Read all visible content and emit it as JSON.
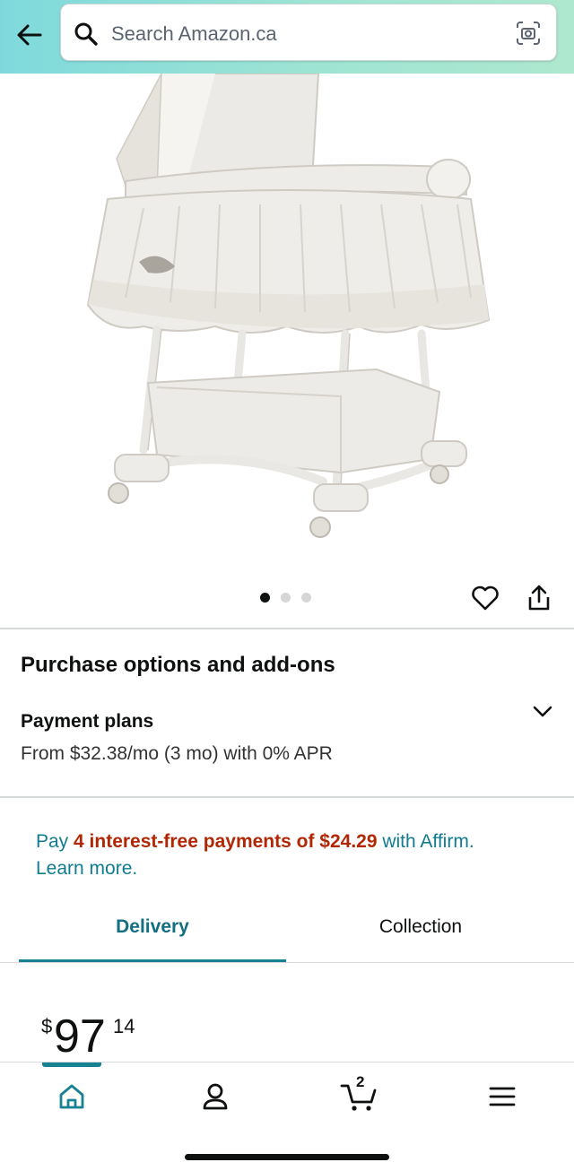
{
  "header": {
    "search_placeholder": "Search Amazon.ca",
    "icons": {
      "back": "arrow-left-icon",
      "search": "magnifier-icon",
      "camera": "camera-scan-icon"
    }
  },
  "product_gallery": {
    "image_alt": "bassinet-photo",
    "dots_total": 3,
    "dots_active_index": 0,
    "icons": {
      "wishlist": "heart-icon",
      "share": "share-icon"
    }
  },
  "purchase_options": {
    "title": "Purchase options and add-ons",
    "payment_plans_label": "Payment plans",
    "payment_plans_detail": "From $32.38/mo (3 mo) with 0% APR"
  },
  "affirm": {
    "prefix": "Pay ",
    "highlight": "4 interest-free payments of $24.29",
    "suffix": " with Affirm.",
    "learn_more": "Learn more."
  },
  "tabs": [
    {
      "label": "Delivery",
      "active": true
    },
    {
      "label": "Collection",
      "active": false
    }
  ],
  "price": {
    "symbol": "$",
    "whole": "97",
    "fraction": "14"
  },
  "bottom_nav": {
    "items": [
      {
        "name": "home",
        "icon": "home-icon",
        "active": true
      },
      {
        "name": "account",
        "icon": "user-icon",
        "active": false
      },
      {
        "name": "cart",
        "icon": "cart-icon",
        "active": false
      },
      {
        "name": "menu",
        "icon": "hamburger-menu-icon",
        "active": false
      }
    ],
    "cart_count": "2"
  },
  "colors": {
    "header_start": "#7fd9dc",
    "header_end": "#aee8cf",
    "link_teal": "#117c8f",
    "price_red": "#b12704",
    "tab_active": "#146e82"
  }
}
